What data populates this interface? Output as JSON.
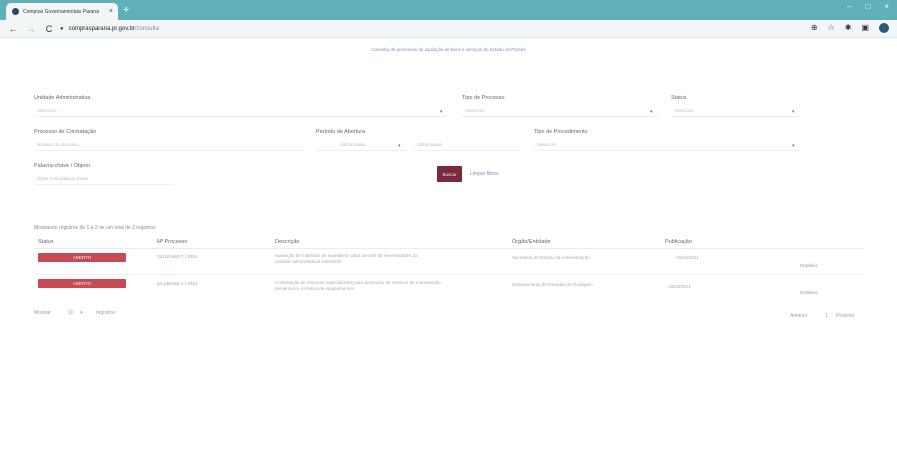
{
  "browser": {
    "tab_title": "Compras Governamentais Paraná",
    "tab_close": "×",
    "new_tab": "+",
    "window_controls": [
      "‒",
      "□",
      "×"
    ],
    "nav": {
      "back": "←",
      "forward": "→",
      "reload": "C",
      "lock": "●"
    },
    "url_main": "comprasparana.pr.gov.br",
    "url_rest": "/consulta",
    "toolbar_icons": [
      "⊕",
      "☆",
      "✱",
      "▣"
    ]
  },
  "banner": "Consulta de processos de aquisição de bens e serviços do Estado do Paraná",
  "filters": {
    "unidade_label": "Unidade Administrativa",
    "unidade_placeholder": "Selecione",
    "tipo_label": "Tipo de Processo",
    "tipo_placeholder": "Selecione",
    "status_label": "Status",
    "status_placeholder": "Selecione",
    "processo_label": "Processo de Contratação",
    "processo_placeholder": "Número do processo",
    "periodo_label": "Período de Abertura",
    "periodo_inicio": "dd/mm/aaaa",
    "periodo_fim": "dd/mm/aaaa",
    "objeto_label": "Tipo de Procedimento",
    "objeto_placeholder": "Selecione",
    "palavra_label": "Palavra-chave / Objeto",
    "palavra_placeholder": "Digite uma palavra-chave",
    "buscar": "Buscar",
    "limpar": "Limpar filtros",
    "caret": "▾"
  },
  "results": {
    "info": "Mostrando registros de 1 a 2 de um total de 2 registros",
    "headers": [
      "Status",
      "Nº Processo",
      "Descrição",
      "Órgão/Entidade",
      "Publicação"
    ],
    "rows": [
      {
        "status": "ABERTO",
        "processo": "24.010.693-7 / 2024",
        "descricao_1": "Aquisição de materiais de expediente para atender às necessidades da",
        "descricao_2": "unidade administrativa solicitante",
        "orgao": "Secretaria de Estado da Administração",
        "publicacao": "15/03/2024",
        "acao": "Detalhes"
      },
      {
        "status": "ABERTO",
        "processo": "24.108.552-1 / 2024",
        "descricao_1": "Contratação de empresa especializada para prestação de serviços de manutenção",
        "descricao_2": "preventiva e corretiva de equipamentos",
        "orgao": "Departamento de Estradas de Rodagem",
        "publicacao": "18/03/2024",
        "acao": "Detalhes"
      }
    ]
  },
  "footer": {
    "show_label": "Mostrar",
    "show_value": "10",
    "per_page": "registros",
    "prev": "Anterior",
    "page": "1",
    "next": "Próximo"
  }
}
